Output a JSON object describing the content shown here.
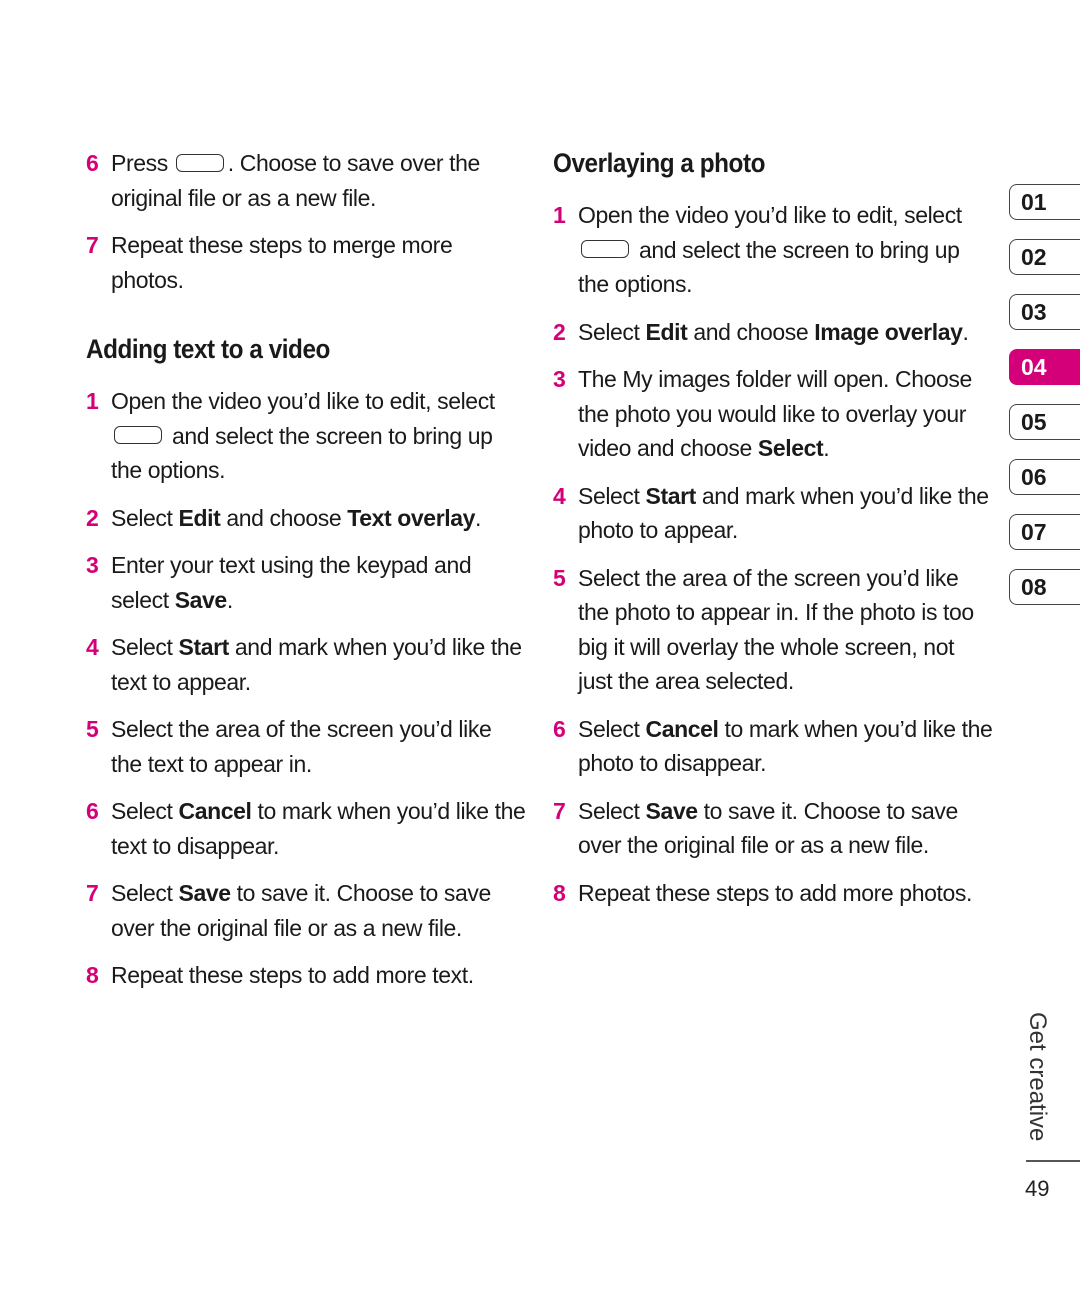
{
  "accent_color": "#d4007a",
  "left": {
    "intro_steps": [
      {
        "num": "6",
        "parts": [
          {
            "t": "Press "
          },
          {
            "key": true
          },
          {
            "t": ". Choose to save over the original file or as a new file."
          }
        ]
      },
      {
        "num": "7",
        "parts": [
          {
            "t": "Repeat these steps to merge more photos."
          }
        ]
      }
    ],
    "heading": "Adding text to a video",
    "steps": [
      {
        "num": "1",
        "parts": [
          {
            "t": "Open the video you’d like to edit, select "
          },
          {
            "key": true,
            "lead": true
          },
          {
            "t": "and select the screen to bring up the options."
          }
        ]
      },
      {
        "num": "2",
        "parts": [
          {
            "t": "Select "
          },
          {
            "b": "Edit"
          },
          {
            "t": " and choose "
          },
          {
            "b": "Text overlay"
          },
          {
            "t": "."
          }
        ]
      },
      {
        "num": "3",
        "parts": [
          {
            "t": "Enter your text using the keypad and select "
          },
          {
            "b": "Save"
          },
          {
            "t": "."
          }
        ]
      },
      {
        "num": "4",
        "parts": [
          {
            "t": "Select "
          },
          {
            "b": "Start"
          },
          {
            "t": " and mark when you’d like the text to appear."
          }
        ]
      },
      {
        "num": "5",
        "parts": [
          {
            "t": "Select the area of the screen you’d like the text to appear in."
          }
        ]
      },
      {
        "num": "6",
        "parts": [
          {
            "t": "Select "
          },
          {
            "b": "Cancel"
          },
          {
            "t": " to mark when you’d like the text to disappear."
          }
        ]
      },
      {
        "num": "7",
        "parts": [
          {
            "t": "Select "
          },
          {
            "b": "Save"
          },
          {
            "t": " to save it. Choose to save over the original file or as a new file."
          }
        ]
      },
      {
        "num": "8",
        "parts": [
          {
            "t": "Repeat these steps to add more text."
          }
        ]
      }
    ]
  },
  "right": {
    "heading": "Overlaying a photo",
    "steps": [
      {
        "num": "1",
        "parts": [
          {
            "t": "Open the video you’d like to edit, select "
          },
          {
            "key": true,
            "lead": true
          },
          {
            "t": "and select the screen to bring up the options."
          }
        ]
      },
      {
        "num": "2",
        "parts": [
          {
            "t": "Select "
          },
          {
            "b": "Edit"
          },
          {
            "t": " and choose "
          },
          {
            "b": "Image overlay"
          },
          {
            "t": "."
          }
        ]
      },
      {
        "num": "3",
        "parts": [
          {
            "t": "The My images folder will open. Choose the photo you would like to overlay your video and choose "
          },
          {
            "b": "Select"
          },
          {
            "t": "."
          }
        ]
      },
      {
        "num": "4",
        "parts": [
          {
            "t": "Select "
          },
          {
            "b": "Start"
          },
          {
            "t": " and mark when you’d like the photo to appear."
          }
        ]
      },
      {
        "num": "5",
        "parts": [
          {
            "t": "Select the area of the screen you’d like the photo to appear in. If the photo is too big it will overlay the whole screen, not just the area selected."
          }
        ]
      },
      {
        "num": "6",
        "parts": [
          {
            "t": "Select "
          },
          {
            "b": "Cancel"
          },
          {
            "t": " to mark when you’d like the photo to disappear."
          }
        ]
      },
      {
        "num": "7",
        "parts": [
          {
            "t": "Select "
          },
          {
            "b": "Save"
          },
          {
            "t": " to save it. Choose to save over the original file or as a new file."
          }
        ]
      },
      {
        "num": "8",
        "parts": [
          {
            "t": "Repeat these steps to add more photos."
          }
        ]
      }
    ]
  },
  "chapter_tabs": [
    {
      "label": "01",
      "active": false
    },
    {
      "label": "02",
      "active": false
    },
    {
      "label": "03",
      "active": false
    },
    {
      "label": "04",
      "active": true
    },
    {
      "label": "05",
      "active": false
    },
    {
      "label": "06",
      "active": false
    },
    {
      "label": "07",
      "active": false
    },
    {
      "label": "08",
      "active": false
    }
  ],
  "section_label": "Get creative",
  "page_number": "49"
}
